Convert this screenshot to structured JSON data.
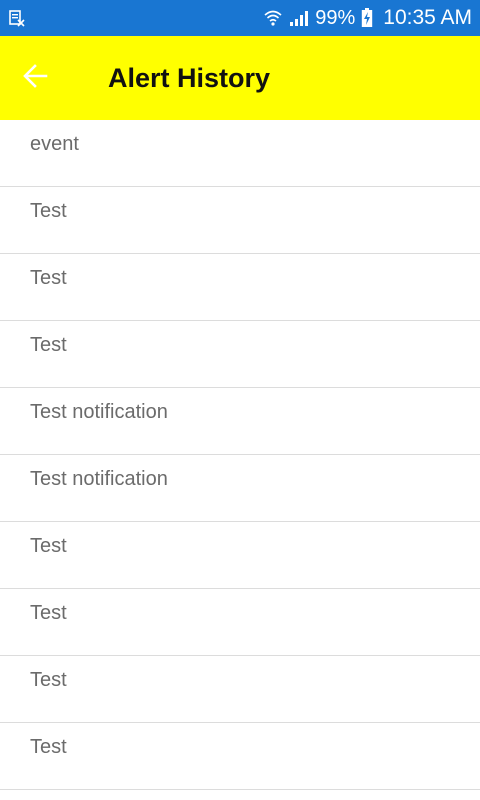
{
  "status_bar": {
    "battery_percent": "99%",
    "time": "10:35 AM",
    "icons": [
      "app-notification-icon",
      "wifi-icon",
      "signal-icon",
      "battery-charging-icon"
    ]
  },
  "app_bar": {
    "title": "Alert History",
    "back_icon": "arrow-back-icon",
    "background_color": "#ffff00"
  },
  "alerts": [
    {
      "label": "event"
    },
    {
      "label": "Test"
    },
    {
      "label": "Test"
    },
    {
      "label": "Test"
    },
    {
      "label": "Test notification"
    },
    {
      "label": "Test notification"
    },
    {
      "label": "Test"
    },
    {
      "label": "Test"
    },
    {
      "label": "Test"
    },
    {
      "label": "Test"
    }
  ]
}
